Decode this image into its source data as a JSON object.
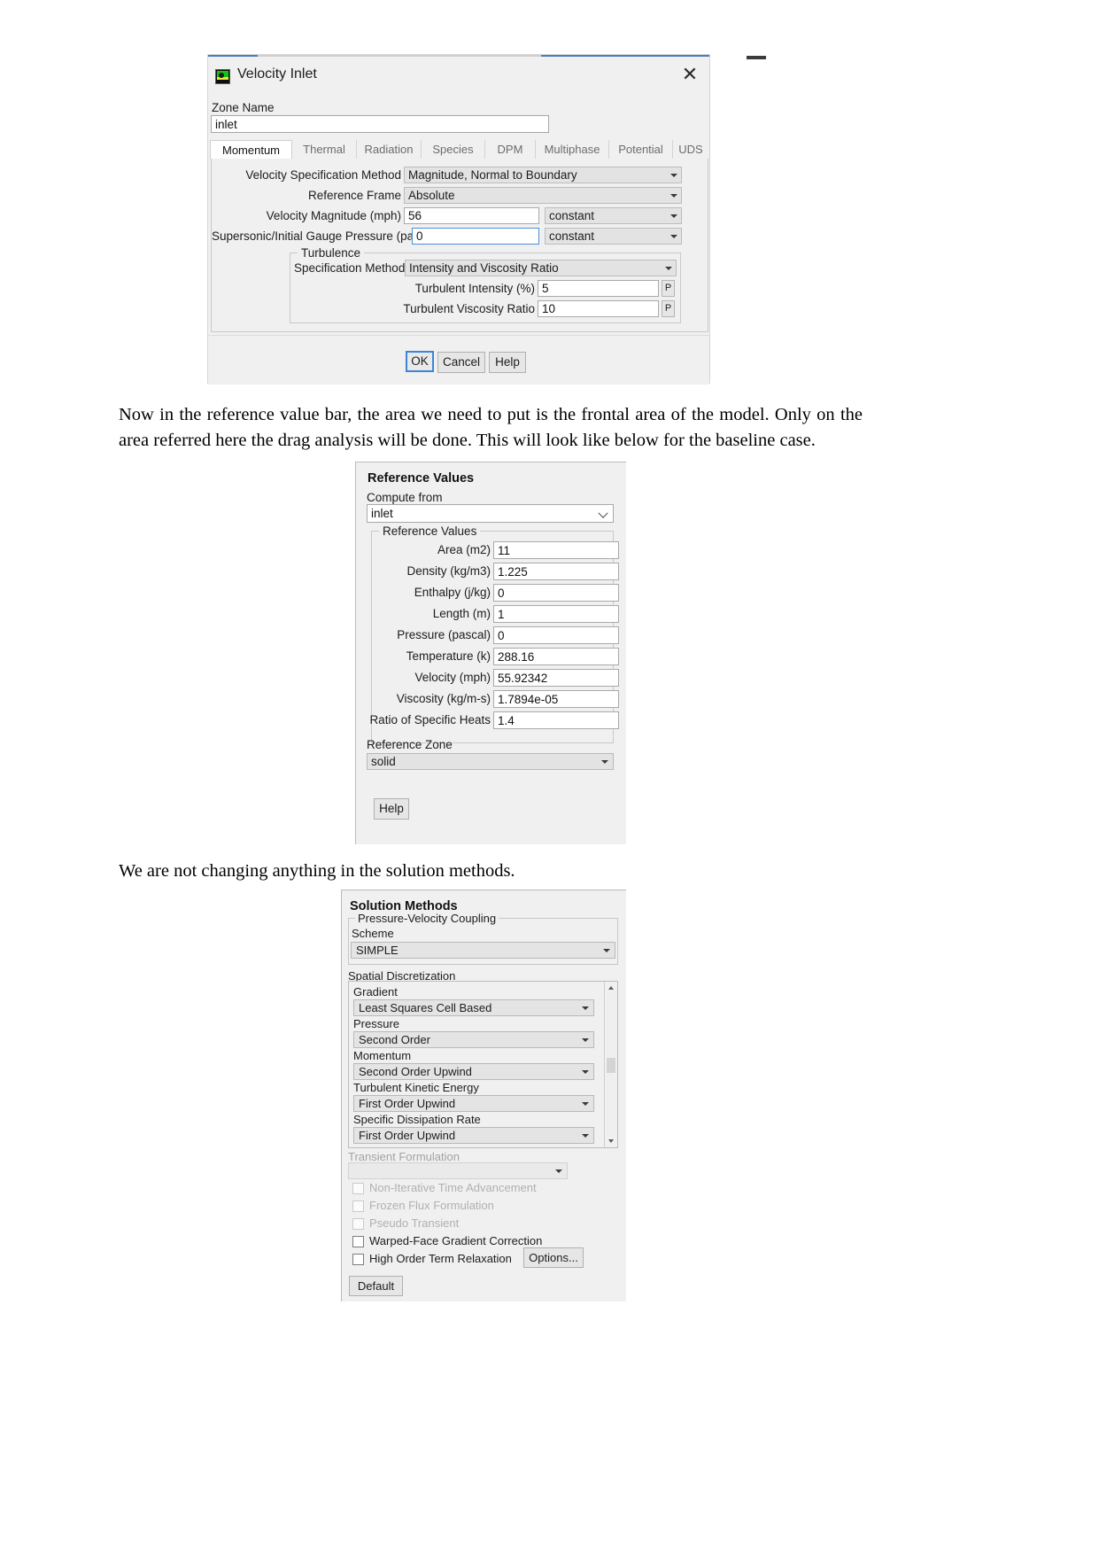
{
  "paragraphs": [
    {
      "id": "p1",
      "text": "Now in the reference value bar, the area we need to put is the frontal area of the model. Only on the area referred here the drag analysis will be done. This will look like below for the baseline case."
    },
    {
      "id": "p2",
      "text": "We are not changing anything in the solution methods."
    }
  ],
  "velocity_inlet": {
    "title": "Velocity Inlet",
    "close_label": "✕",
    "zone_name_label": "Zone Name",
    "zone_name_value": "inlet",
    "tabs": [
      {
        "label": "Momentum",
        "active": true
      },
      {
        "label": "Thermal",
        "active": false
      },
      {
        "label": "Radiation",
        "active": false
      },
      {
        "label": "Species",
        "active": false
      },
      {
        "label": "DPM",
        "active": false
      },
      {
        "label": "Multiphase",
        "active": false
      },
      {
        "label": "Potential",
        "active": false
      },
      {
        "label": "UDS",
        "active": false
      }
    ],
    "fields": {
      "velocity_spec_method_label": "Velocity Specification Method",
      "velocity_spec_method_value": "Magnitude, Normal to Boundary",
      "reference_frame_label": "Reference Frame",
      "reference_frame_value": "Absolute",
      "velocity_magnitude_label": "Velocity Magnitude (mph)",
      "velocity_magnitude_value": "56",
      "velocity_magnitude_profile": "constant",
      "gauge_pressure_label": "Supersonic/Initial Gauge Pressure (pascal)",
      "gauge_pressure_value": "0",
      "gauge_pressure_profile": "constant"
    },
    "turbulence": {
      "group_label": "Turbulence",
      "spec_method_label": "Specification Method",
      "spec_method_value": "Intensity and Viscosity Ratio",
      "intensity_label": "Turbulent Intensity (%)",
      "intensity_value": "5",
      "intensity_profile_btn": "P",
      "viscosity_ratio_label": "Turbulent Viscosity Ratio",
      "viscosity_ratio_value": "10",
      "viscosity_ratio_profile_btn": "P"
    },
    "buttons": {
      "ok": "OK",
      "cancel": "Cancel",
      "help": "Help"
    }
  },
  "reference_values": {
    "heading": "Reference Values",
    "compute_from_label": "Compute from",
    "compute_from_value": "inlet",
    "group_label": "Reference Values",
    "rows": [
      {
        "label": "Area (m2)",
        "value": "11"
      },
      {
        "label": "Density (kg/m3)",
        "value": "1.225"
      },
      {
        "label": "Enthalpy (j/kg)",
        "value": "0"
      },
      {
        "label": "Length (m)",
        "value": "1"
      },
      {
        "label": "Pressure (pascal)",
        "value": "0"
      },
      {
        "label": "Temperature (k)",
        "value": "288.16"
      },
      {
        "label": "Velocity (mph)",
        "value": "55.92342"
      },
      {
        "label": "Viscosity (kg/m-s)",
        "value": "1.7894e-05"
      },
      {
        "label": "Ratio of Specific Heats",
        "value": "1.4"
      }
    ],
    "reference_zone_label": "Reference Zone",
    "reference_zone_value": "solid",
    "help_button": "Help"
  },
  "solution_methods": {
    "heading": "Solution Methods",
    "pvc_group_label": "Pressure-Velocity Coupling",
    "scheme_label": "Scheme",
    "scheme_value": "SIMPLE",
    "spatial_group_label": "Spatial Discretization",
    "spatial_rows": [
      {
        "label": "Gradient",
        "value": "Least Squares Cell Based"
      },
      {
        "label": "Pressure",
        "value": "Second Order"
      },
      {
        "label": "Momentum",
        "value": "Second Order Upwind"
      },
      {
        "label": "Turbulent Kinetic Energy",
        "value": "First Order Upwind"
      },
      {
        "label": "Specific Dissipation Rate",
        "value": "First Order Upwind"
      }
    ],
    "transient_group_label": "Transient Formulation",
    "transient_value": "",
    "checkboxes": [
      {
        "label": "Non-Iterative Time Advancement",
        "checked": false,
        "disabled": true
      },
      {
        "label": "Frozen Flux Formulation",
        "checked": false,
        "disabled": true
      },
      {
        "label": "Pseudo Transient",
        "checked": false,
        "disabled": true
      },
      {
        "label": "Warped-Face Gradient Correction",
        "checked": false,
        "disabled": false
      },
      {
        "label": "High Order Term Relaxation",
        "checked": false,
        "disabled": false
      }
    ],
    "options_button": "Options...",
    "default_button": "Default"
  }
}
